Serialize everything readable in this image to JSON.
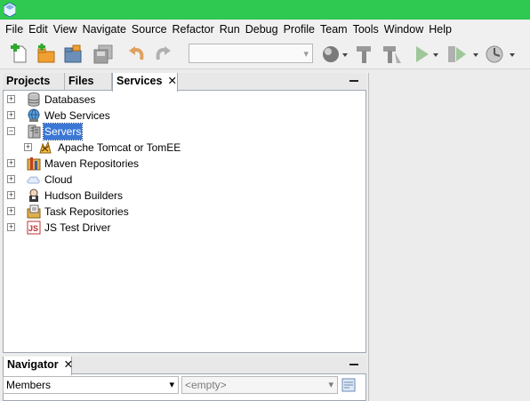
{
  "menu": [
    "File",
    "Edit",
    "View",
    "Navigate",
    "Source",
    "Refactor",
    "Run",
    "Debug",
    "Profile",
    "Team",
    "Tools",
    "Window",
    "Help"
  ],
  "toolbar": {
    "config_combo_value": "",
    "icons": [
      "new-file-icon",
      "new-project-icon",
      "open-project-icon",
      "save-all-icon",
      "undo-icon",
      "redo-icon",
      "browser-icon",
      "build-icon",
      "clean-build-icon",
      "run-icon",
      "debug-icon",
      "profile-icon"
    ]
  },
  "left_tabs": [
    {
      "label": "Projects",
      "active": false
    },
    {
      "label": "Files",
      "active": false
    },
    {
      "label": "Services",
      "active": true,
      "close": "✕"
    }
  ],
  "tree": [
    {
      "label": "Databases",
      "icon": "database-icon",
      "expanded": false,
      "level": 0
    },
    {
      "label": "Web Services",
      "icon": "web-services-icon",
      "expanded": false,
      "level": 0
    },
    {
      "label": "Servers",
      "icon": "servers-icon",
      "expanded": true,
      "selected": true,
      "level": 0
    },
    {
      "label": "Apache Tomcat or TomEE",
      "icon": "tomcat-icon",
      "expanded": false,
      "level": 1
    },
    {
      "label": "Maven Repositories",
      "icon": "maven-icon",
      "expanded": false,
      "level": 0
    },
    {
      "label": "Cloud",
      "icon": "cloud-icon",
      "expanded": false,
      "level": 0
    },
    {
      "label": "Hudson Builders",
      "icon": "hudson-icon",
      "expanded": false,
      "level": 0
    },
    {
      "label": "Task Repositories",
      "icon": "task-repo-icon",
      "expanded": false,
      "level": 0
    },
    {
      "label": "JS Test Driver",
      "icon": "js-test-icon",
      "expanded": false,
      "level": 0
    }
  ],
  "navigator": {
    "tab_label": "Navigator",
    "close": "✕",
    "members_value": "Members",
    "filter_value": "<empty>"
  }
}
